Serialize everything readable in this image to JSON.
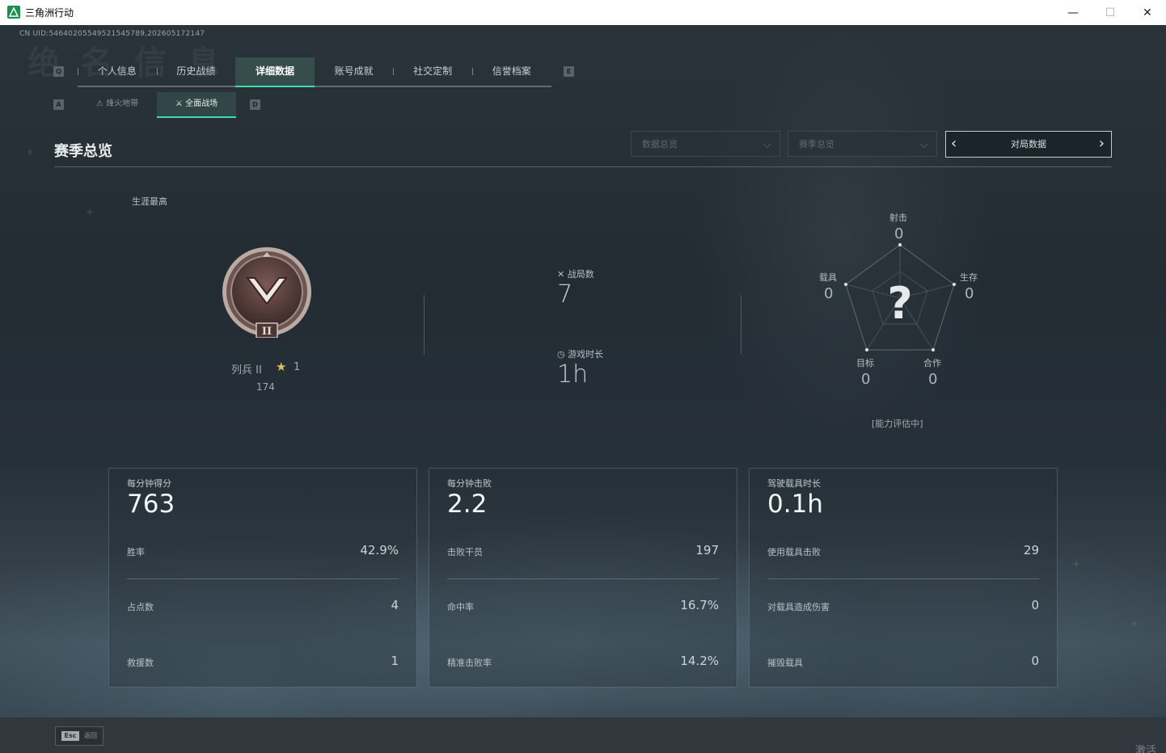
{
  "window": {
    "title": "三角洲行动",
    "minimize": "—",
    "maximize": "☐",
    "close": "✕"
  },
  "uid": "CN UID:5464020554952154578​9,202605172147",
  "bg_title": "绝 名 信 息",
  "keys": {
    "prev_tab": "Q",
    "next_tab": "E",
    "prev_sub": "A",
    "next_sub": "D"
  },
  "tabs": [
    {
      "label": "个人信息",
      "active": false
    },
    {
      "label": "历史战绩",
      "active": false
    },
    {
      "label": "详细数据",
      "active": true
    },
    {
      "label": "账号成就",
      "active": false
    },
    {
      "label": "社交定制",
      "active": false
    },
    {
      "label": "信誉档案",
      "active": false
    }
  ],
  "subtabs": [
    {
      "label": "烽火地带",
      "icon": "flame-zone-icon",
      "active": false
    },
    {
      "label": "全面战场",
      "icon": "full-battlefield-icon",
      "active": true
    }
  ],
  "section": {
    "title": "赛季总览"
  },
  "filters": {
    "dropdown1": "数据总览",
    "dropdown2": "赛季总览",
    "pager_label": "对局数据"
  },
  "career": {
    "label": "生涯最高",
    "rank_name": "列兵 II",
    "star_count": "1",
    "score": "174",
    "badge_roman": "II"
  },
  "summary": {
    "matches_label": "战局数",
    "matches_value": "7",
    "playtime_label": "游戏时长",
    "playtime_value": "1h"
  },
  "radar": {
    "center": "?",
    "shooting": {
      "label": "射击",
      "value": "0"
    },
    "survival": {
      "label": "生存",
      "value": "0"
    },
    "vehicle": {
      "label": "载具",
      "value": "0"
    },
    "objective": {
      "label": "目标",
      "value": "0"
    },
    "teamwork": {
      "label": "合作",
      "value": "0"
    },
    "status": "[能力评估中]"
  },
  "cards": [
    {
      "head_label": "每分钟得分",
      "head_value": "763",
      "rows": [
        {
          "label": "胜率",
          "value": "42.9%"
        },
        {
          "label": "占点数",
          "value": "4"
        },
        {
          "label": "救援数",
          "value": "1"
        }
      ]
    },
    {
      "head_label": "每分钟击败",
      "head_value": "2.2",
      "rows": [
        {
          "label": "击败干员",
          "value": "197"
        },
        {
          "label": "命中率",
          "value": "16.7%"
        },
        {
          "label": "精准击败率",
          "value": "14.2%"
        }
      ]
    },
    {
      "head_label": "驾驶载具时长",
      "head_value": "0.1h",
      "rows": [
        {
          "label": "使用载具击败",
          "value": "29"
        },
        {
          "label": "对载具造成伤害",
          "value": "0"
        },
        {
          "label": "摧毁载具",
          "value": "0"
        }
      ]
    }
  ],
  "bottom": {
    "esc_key": "Esc",
    "esc_label": "返回",
    "corner": "激活"
  },
  "colors": {
    "accent": "#38e0a8",
    "background": "#1d262d",
    "titlebar": "#ffffff"
  }
}
